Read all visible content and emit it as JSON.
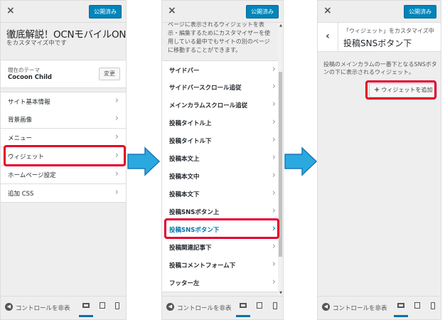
{
  "common": {
    "close_glyph": "×",
    "published": "公開済み",
    "hide_controls": "コントロールを非表示",
    "hide_controls_short": "コントロールを非表",
    "chevron": "›",
    "back_glyph": "‹"
  },
  "panel1": {
    "site_title": "徹底解説！OCNモバイルON",
    "customizing": "をカスタマイズ中です",
    "theme_caption": "現在のテーマ",
    "theme_name": "Cocoon Child",
    "change_button": "変更",
    "items": [
      {
        "label": "サイト基本情報"
      },
      {
        "label": "背景画像"
      },
      {
        "label": "メニュー"
      },
      {
        "label": "ウィジェット"
      },
      {
        "label": "ホームページ設定"
      },
      {
        "label": "追加 CSS"
      }
    ]
  },
  "panel2": {
    "description": "ページに表示されるウィジェットを表示・編集するためにカスタマイザーを使用している最中でもサイトの別のページに移動することができます。",
    "items": [
      {
        "label": "サイドバー"
      },
      {
        "label": "サイドバースクロール追従"
      },
      {
        "label": "メインカラムスクロール追従"
      },
      {
        "label": "投稿タイトル上"
      },
      {
        "label": "投稿タイトル下"
      },
      {
        "label": "投稿本文上"
      },
      {
        "label": "投稿本文中"
      },
      {
        "label": "投稿本文下"
      },
      {
        "label": "投稿SNSボタン上"
      },
      {
        "label": "投稿SNSボタン下"
      },
      {
        "label": "投稿関連記事下"
      },
      {
        "label": "投稿コメントフォーム下"
      },
      {
        "label": "フッター左"
      }
    ]
  },
  "panel3": {
    "breadcrumb": "「ウィジェット」をカスタマイズ中",
    "title": "投稿SNSボタン下",
    "description": "投稿のメインカラムの一番下となるSNSボタンの下に表示されるウィジェット。",
    "add_widget": "ウィジェットを追加"
  },
  "colors": {
    "highlight": "#e4002b",
    "arrow": "#2aa9e0",
    "accent": "#0085ba"
  }
}
